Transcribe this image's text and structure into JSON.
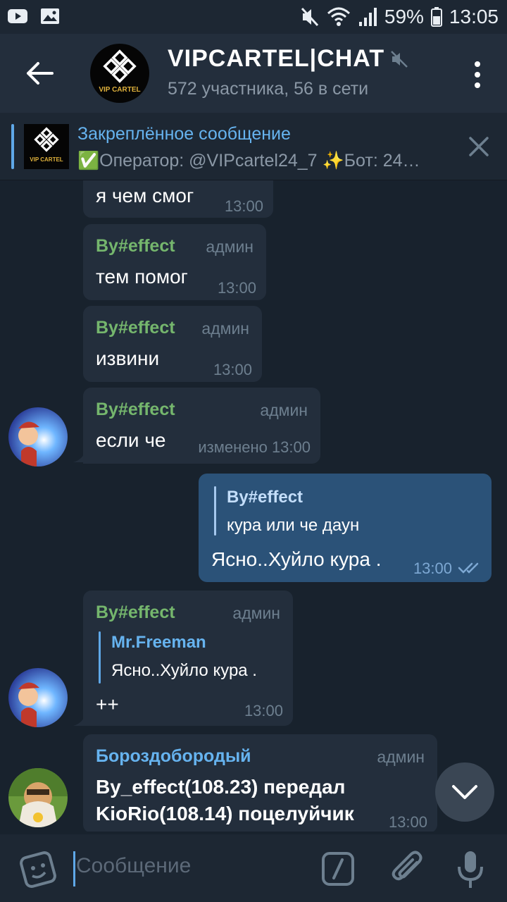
{
  "status_bar": {
    "battery": "59%",
    "time": "13:05"
  },
  "header": {
    "title": "VIPCARTEL|CHAT",
    "subtitle": "572 участника, 56 в сети",
    "avatar_label": "VIP CARTEL"
  },
  "pinned": {
    "title": "Закреплённое сообщение",
    "text": "✅Оператор: @VIPcartel24_7 ✨Бот: 24…",
    "thumb_label": "VIP CARTEL",
    "ghost_text": "кура или че даун"
  },
  "messages": [
    {
      "text": "я чем смог",
      "time": "13:00"
    },
    {
      "sender": "By#effect",
      "role": "админ",
      "text": "тем помог",
      "time": "13:00"
    },
    {
      "sender": "By#effect",
      "role": "админ",
      "text": "извини",
      "time": "13:00"
    },
    {
      "sender": "By#effect",
      "role": "админ",
      "text": "если че",
      "time": "изменено 13:00"
    },
    {
      "reply_name": "By#effect",
      "reply_text": "кура или че даун",
      "text": "Ясно..Хуйло кура .",
      "time": "13:00"
    },
    {
      "sender": "By#effect",
      "role": "админ",
      "reply_name": "Mr.Freeman",
      "reply_text": "Ясно..Хуйло кура .",
      "text": "++",
      "time": "13:00"
    },
    {
      "sender": "Бороздобородый",
      "role": "админ",
      "line1": "By_effect(108.23) передал",
      "line2": "KioRio(108.14) поцелуйчик",
      "time": "13:00"
    }
  ],
  "input": {
    "placeholder": "Сообщение"
  },
  "colors": {
    "accent": "#5fa8e8",
    "sender": "#75b66d",
    "bubble_in": "#232e3c",
    "bubble_out": "#2b5278",
    "background": "#18222d"
  }
}
